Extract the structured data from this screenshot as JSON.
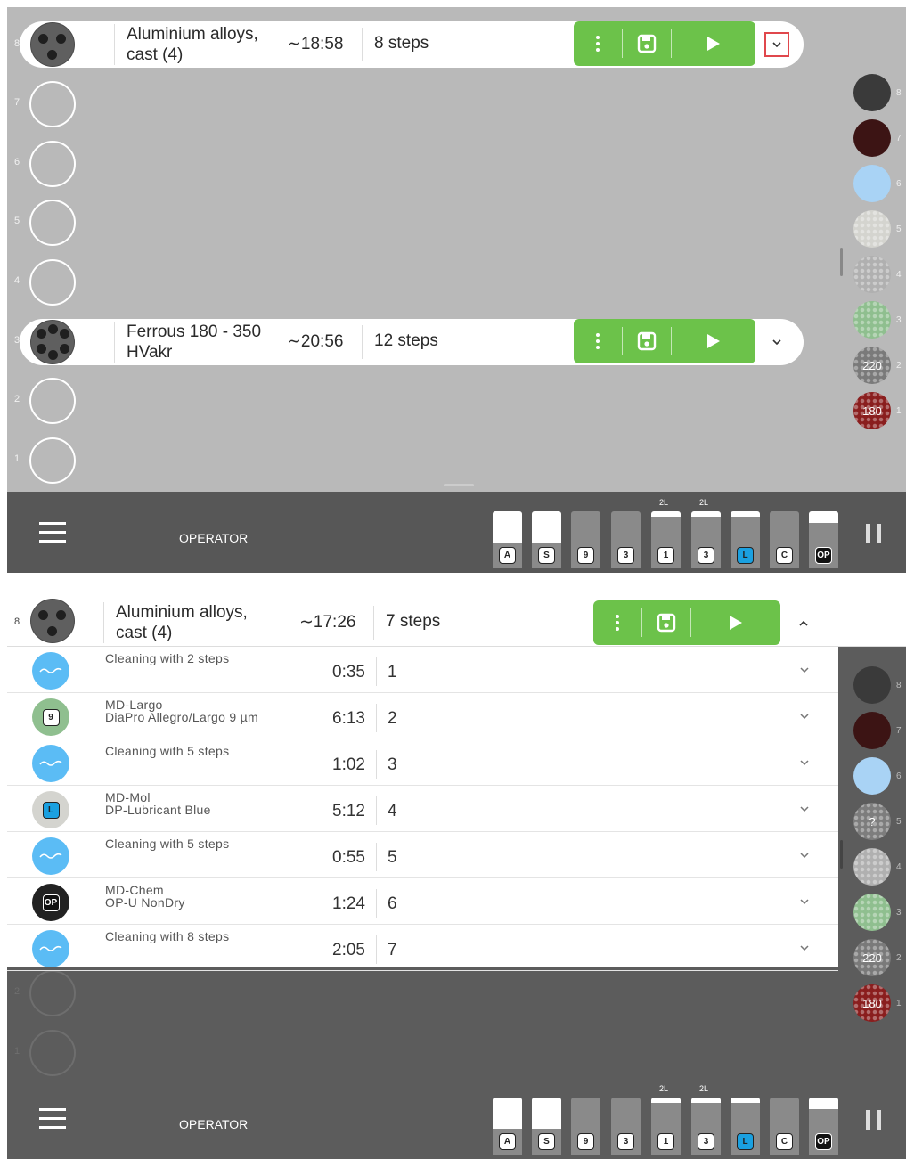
{
  "screen1": {
    "slots": [
      {
        "n": "8"
      },
      {
        "n": "7"
      },
      {
        "n": "6"
      },
      {
        "n": "5"
      },
      {
        "n": "4"
      },
      {
        "n": "3"
      },
      {
        "n": "2"
      },
      {
        "n": "1"
      }
    ],
    "row_top": {
      "name": "Aluminium alloys, cast (4)",
      "time": "∼18:58",
      "steps": "8 steps"
    },
    "row_mid": {
      "name": "Ferrous 180 - 350 HVakr",
      "time": "∼20:56",
      "steps": "12 steps"
    },
    "discs": [
      {
        "n": "8",
        "label": ""
      },
      {
        "n": "7",
        "label": ""
      },
      {
        "n": "6",
        "label": ""
      },
      {
        "n": "5",
        "label": ""
      },
      {
        "n": "4",
        "label": ""
      },
      {
        "n": "3",
        "label": ""
      },
      {
        "n": "2",
        "label": "220"
      },
      {
        "n": "1",
        "label": "180"
      }
    ],
    "operator": "OPERATOR"
  },
  "screen2": {
    "header": {
      "slot": "8",
      "name": "Aluminium alloys, cast (4)",
      "time": "∼17:26",
      "steps": "7 steps"
    },
    "steps": [
      {
        "line1": "Cleaning with 2 steps",
        "line2": "",
        "time": "0:35",
        "num": "1",
        "icon": "wave-icon",
        "badge": ""
      },
      {
        "line1": "MD-Largo",
        "line2": "DiaPro Allegro/Largo 9 µm",
        "time": "6:13",
        "num": "2",
        "icon": "disc",
        "badge": "9"
      },
      {
        "line1": "Cleaning with 5 steps",
        "line2": "",
        "time": "1:02",
        "num": "3",
        "icon": "wave-icon",
        "badge": ""
      },
      {
        "line1": "MD-Mol",
        "line2": "DP-Lubricant Blue",
        "time": "5:12",
        "num": "4",
        "icon": "disc",
        "badge": "L"
      },
      {
        "line1": "Cleaning with 5 steps",
        "line2": "",
        "time": "0:55",
        "num": "5",
        "icon": "wave-icon",
        "badge": ""
      },
      {
        "line1": "MD-Chem",
        "line2": "OP-U NonDry",
        "time": "1:24",
        "num": "6",
        "icon": "disc",
        "badge": "OP"
      },
      {
        "line1": "Cleaning with 8 steps",
        "line2": "",
        "time": "2:05",
        "num": "7",
        "icon": "wave-icon",
        "badge": ""
      }
    ],
    "slots_visible": [
      {
        "n": "2"
      },
      {
        "n": "1"
      }
    ],
    "discs": [
      {
        "n": "8",
        "label": ""
      },
      {
        "n": "7",
        "label": ""
      },
      {
        "n": "6",
        "label": ""
      },
      {
        "n": "5",
        "label": "?"
      },
      {
        "n": "4",
        "label": ""
      },
      {
        "n": "3",
        "label": ""
      },
      {
        "n": "2",
        "label": "220"
      },
      {
        "n": "1",
        "label": "180"
      }
    ],
    "operator": "OPERATOR"
  },
  "bottles": [
    {
      "label": "A",
      "cap": "",
      "fill": 0.55
    },
    {
      "label": "S",
      "cap": "",
      "fill": 0.55
    },
    {
      "label": "9",
      "cap": "",
      "fill": 0
    },
    {
      "label": "3",
      "cap": "",
      "fill": 0
    },
    {
      "label": "1",
      "cap": "2L",
      "fill": 0.1
    },
    {
      "label": "3",
      "cap": "2L",
      "fill": 0.1
    },
    {
      "label": "L",
      "cap": "",
      "fill": 0.1
    },
    {
      "label": "C",
      "cap": "",
      "fill": 0
    },
    {
      "label": "OP",
      "cap": "",
      "fill": 0.2
    }
  ],
  "colors": {
    "green": "#6cc24a",
    "highlight": "#e0474c",
    "disc8": "#3a3a3a",
    "disc7": "#3c1414",
    "disc6": "#a9d3f5",
    "disc5": "#d4d4cf",
    "disc4": "#b0b0b0",
    "disc3": "#8fbf8f",
    "disc2": "#7a7a7a",
    "disc1": "#8a1e1e"
  }
}
